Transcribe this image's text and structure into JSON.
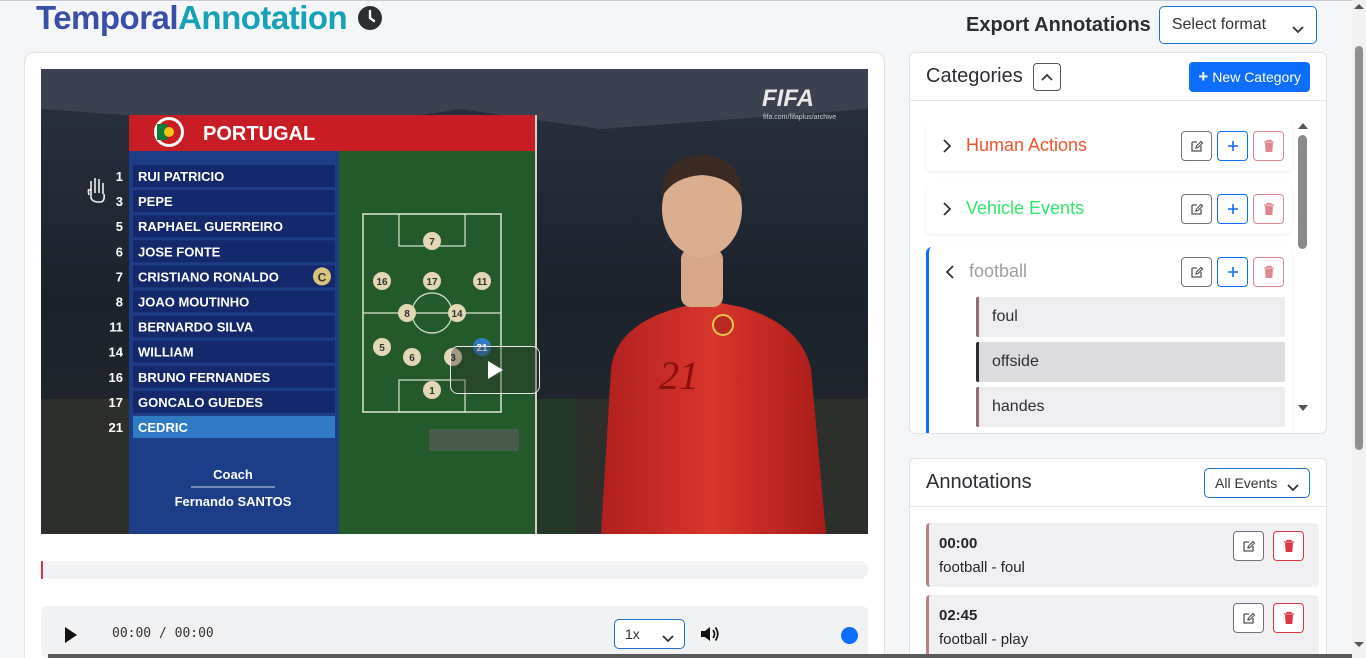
{
  "brand": {
    "part1": "Temporal",
    "part2": "Annotation",
    "icon": "clock-icon"
  },
  "export": {
    "label": "Export Annotations",
    "selected": "Select format"
  },
  "video": {
    "team": "PORTUGAL",
    "watermark": "FIFA",
    "watermark_sub": "fifa.com/fifaplus/archive",
    "players": [
      {
        "num": "1",
        "name": "RUI PATRICIO"
      },
      {
        "num": "3",
        "name": "PEPE"
      },
      {
        "num": "5",
        "name": "RAPHAEL GUERREIRO"
      },
      {
        "num": "6",
        "name": "JOSE FONTE"
      },
      {
        "num": "7",
        "name": "CRISTIANO RONALDO"
      },
      {
        "num": "8",
        "name": "JOAO MOUTINHO"
      },
      {
        "num": "11",
        "name": "BERNARDO SILVA"
      },
      {
        "num": "14",
        "name": "WILLIAM"
      },
      {
        "num": "16",
        "name": "BRUNO FERNANDES"
      },
      {
        "num": "17",
        "name": "GONCALO GUEDES"
      },
      {
        "num": "21",
        "name": "CEDRIC"
      }
    ],
    "captain_mark": "C",
    "coach_label": "Coach",
    "coach_name": "Fernando SANTOS",
    "pitch_numbers": [
      "7",
      "16",
      "17",
      "11",
      "8",
      "14",
      "5",
      "6",
      "3",
      "21",
      "1"
    ],
    "shirt_number": "21"
  },
  "controls": {
    "time": "00:00 / 00:00",
    "speed": "1x",
    "progress": 0
  },
  "categories": {
    "title": "Categories",
    "new_button": "New Category",
    "items": [
      {
        "name": "Human Actions",
        "color": "#f0542d",
        "expanded": false
      },
      {
        "name": "Vehicle Events",
        "color": "#2ee86a",
        "expanded": false
      },
      {
        "name": "football",
        "color": "#9e9ea4",
        "expanded": true,
        "subs": [
          {
            "name": "foul",
            "active": false
          },
          {
            "name": "offside",
            "active": true
          },
          {
            "name": "handes",
            "active": false
          }
        ]
      }
    ]
  },
  "annotations": {
    "title": "Annotations",
    "filter": "All Events",
    "items": [
      {
        "time": "00:00",
        "label": "football - foul"
      },
      {
        "time": "02:45",
        "label": "football - play"
      }
    ]
  }
}
